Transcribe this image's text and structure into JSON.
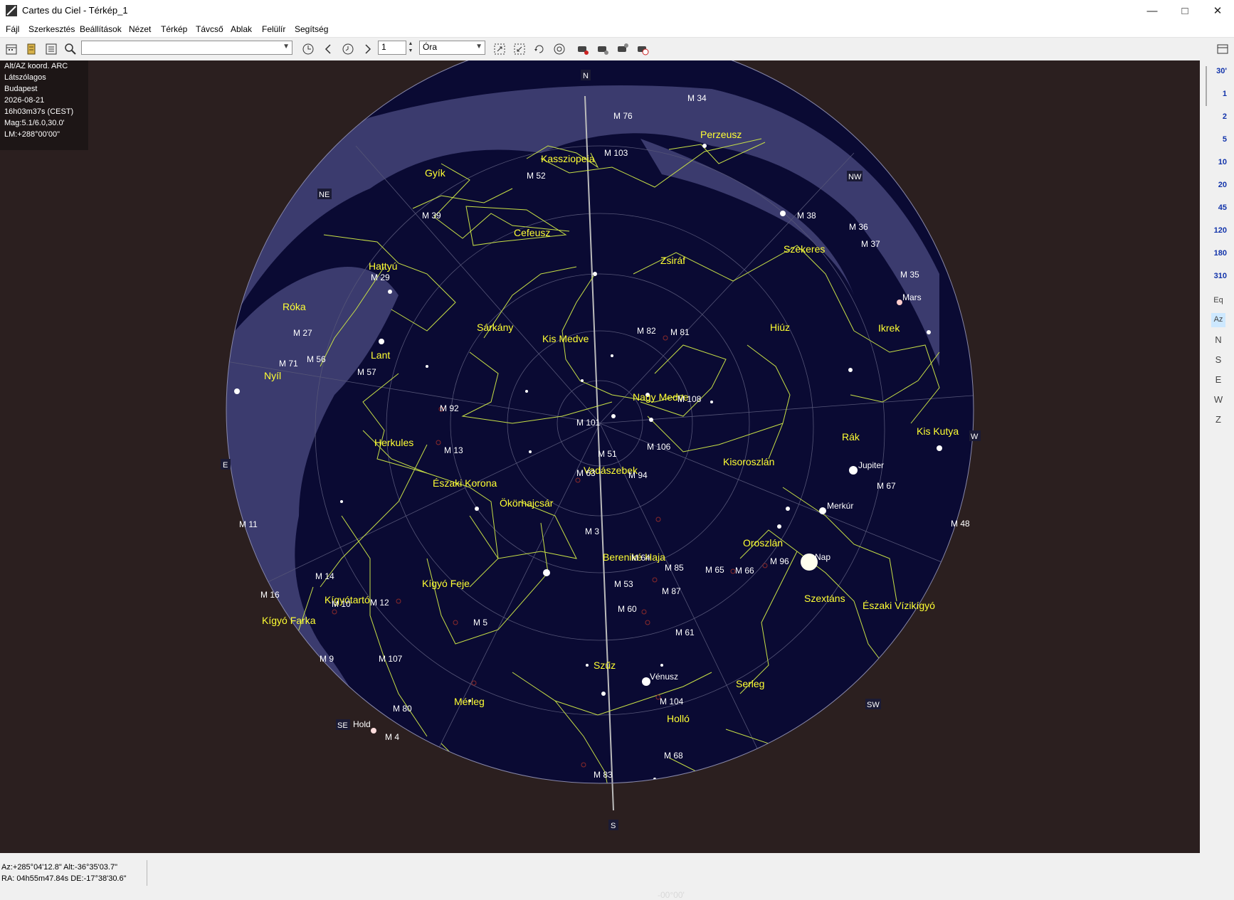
{
  "window": {
    "title": "Cartes du Ciel - Térkép_1",
    "minimize_icon": "minimize-icon",
    "maximize_icon": "maximize-icon",
    "close_icon": "close-icon"
  },
  "menu": [
    "Fájl",
    "Szerkesztés",
    "Beállítások",
    "Nézet",
    "Térkép",
    "Távcső",
    "Ablak",
    "Felülír",
    "Segítség"
  ],
  "toolbar": {
    "search_value": "",
    "time_step_value": "1",
    "time_unit": "Óra"
  },
  "info_panel": {
    "lines": [
      "Alt/AZ koord. ARC",
      "Látszólagos",
      "Budapest",
      "2026-08-21",
      "16h03m37s (CEST)",
      "Mag:5.1/6.0,30.0'",
      "LM:+288°00'00\""
    ]
  },
  "chart": {
    "center_coord": "-00°00'",
    "colors": {
      "sky": "#0a0a33",
      "milky_way": "#3b3b6e",
      "background": "#2b1f1f",
      "constellation_lines": "#c8e046",
      "labels": "#ffff33"
    },
    "directions": [
      {
        "name": "north",
        "label": "N"
      },
      {
        "name": "northeast",
        "label": "NE"
      },
      {
        "name": "east",
        "label": "E"
      },
      {
        "name": "southeast",
        "label": "SE"
      },
      {
        "name": "south",
        "label": "S"
      },
      {
        "name": "southwest",
        "label": "SW"
      },
      {
        "name": "west",
        "label": "W"
      },
      {
        "name": "northwest",
        "label": "NW"
      }
    ],
    "constellations": [
      {
        "id": "kassziopeia",
        "label": "Kassziopeia"
      },
      {
        "id": "perzeusz",
        "label": "Perzeusz"
      },
      {
        "id": "gyik",
        "label": "Gyík"
      },
      {
        "id": "cefeusz",
        "label": "Cefeusz"
      },
      {
        "id": "hattyu",
        "label": "Hattyú"
      },
      {
        "id": "zsiraf",
        "label": "Zsiráf"
      },
      {
        "id": "szekeres",
        "label": "Szekeres"
      },
      {
        "id": "roka",
        "label": "Róka"
      },
      {
        "id": "sarkany",
        "label": "Sárkány"
      },
      {
        "id": "kis-medve",
        "label": "Kis Medve"
      },
      {
        "id": "hiuz",
        "label": "Hiúz"
      },
      {
        "id": "ikrek",
        "label": "Ikrek"
      },
      {
        "id": "lant",
        "label": "Lant"
      },
      {
        "id": "nyil",
        "label": "Nyíl"
      },
      {
        "id": "nagy-medve",
        "label": "Nagy Medve"
      },
      {
        "id": "herkules",
        "label": "Herkules"
      },
      {
        "id": "rak",
        "label": "Rák"
      },
      {
        "id": "kis-kutya",
        "label": "Kis Kutya"
      },
      {
        "id": "kisoroszlan",
        "label": "Kisoroszlán"
      },
      {
        "id": "vadaszebek",
        "label": "Vadászebek"
      },
      {
        "id": "eszaki-korona",
        "label": "Északi Korona"
      },
      {
        "id": "okorhajcsar",
        "label": "Ökörhajcsár"
      },
      {
        "id": "oroszlan",
        "label": "Oroszlán"
      },
      {
        "id": "berenike-haja",
        "label": "Bereniké Haja"
      },
      {
        "id": "kigyo-feje",
        "label": "Kígyó Feje"
      },
      {
        "id": "kigyotarto",
        "label": "Kígyótartó"
      },
      {
        "id": "szextans",
        "label": "Szextáns"
      },
      {
        "id": "eszaki-vizikigyo",
        "label": "Északi Vízikígyó"
      },
      {
        "id": "kigyo-farka",
        "label": "Kígyó Farka"
      },
      {
        "id": "szuz",
        "label": "Szűz"
      },
      {
        "id": "serleg",
        "label": "Serleg"
      },
      {
        "id": "merleg",
        "label": "Mérleg"
      },
      {
        "id": "hollo",
        "label": "Holló"
      }
    ],
    "deep_sky": [
      "M 76",
      "M 34",
      "M 103",
      "M 52",
      "M 39",
      "M 38",
      "M 36",
      "M 37",
      "M 29",
      "M 35",
      "M 27",
      "M 71",
      "M 56",
      "M 57",
      "M 82",
      "M 81",
      "M 92",
      "M 108",
      "M 101",
      "M 13",
      "M 51",
      "M 106",
      "M 63",
      "M 94",
      "M 67",
      "M 11",
      "M 3",
      "M 64",
      "M 85",
      "M 65",
      "M 66",
      "M 96",
      "M 14",
      "M 53",
      "M 16",
      "M 10",
      "M 12",
      "M 87",
      "M 60",
      "M 5",
      "M 61",
      "M 9",
      "M 107",
      "M 104",
      "M 80",
      "M 4",
      "M 68",
      "M 83",
      "M 48"
    ],
    "solar_system": [
      {
        "id": "mars",
        "label": "Mars"
      },
      {
        "id": "jupiter",
        "label": "Jupiter"
      },
      {
        "id": "merkur",
        "label": "Merkúr"
      },
      {
        "id": "nap",
        "label": "Nap"
      },
      {
        "id": "venusz",
        "label": "Vénusz"
      },
      {
        "id": "hold",
        "label": "Hold"
      }
    ]
  },
  "fov_scale": [
    "30'",
    "1",
    "2",
    "5",
    "10",
    "20",
    "45",
    "120",
    "180",
    "310"
  ],
  "sidebar_tools": [
    "Eq",
    "Az",
    "N",
    "S",
    "E",
    "W",
    "Z"
  ],
  "status": {
    "line1": "Az:+285°04'12.8\" Alt:-36°35'03.7\"",
    "line2": "RA: 04h55m47.84s DE:-17°38'30.6\""
  }
}
